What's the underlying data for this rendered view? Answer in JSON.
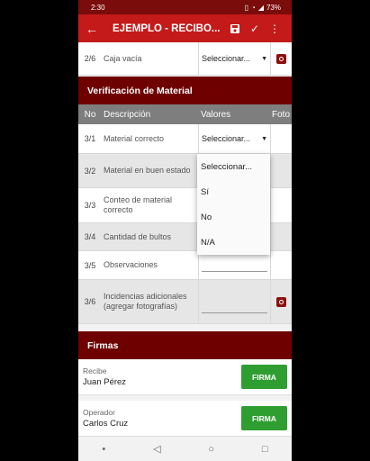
{
  "status_bar": {
    "time": "2:30",
    "battery": "73%"
  },
  "app_bar": {
    "title": "EJEMPLO - RECIBO..."
  },
  "top_row": {
    "no": "2/6",
    "desc": "Caja vacía",
    "value": "Seleccionar..."
  },
  "section_verification": {
    "title": "Verificación de Material"
  },
  "table_headers": {
    "no": "No",
    "desc": "Descripción",
    "val": "Valores",
    "foto": "Foto"
  },
  "rows": [
    {
      "no": "3/1",
      "desc": "Material correcto",
      "value": "Seleccionar..."
    },
    {
      "no": "3/2",
      "desc": "Material en buen estado"
    },
    {
      "no": "3/3",
      "desc": "Conteo de material correcto"
    },
    {
      "no": "3/4",
      "desc": "Cantidad de bultos"
    },
    {
      "no": "3/5",
      "desc": "Observaciones"
    },
    {
      "no": "3/6",
      "desc": "Incidencias adicionales (agregar fotografías)"
    }
  ],
  "dropdown": {
    "options": [
      "Seleccionar...",
      "Sí",
      "No",
      "N/A"
    ]
  },
  "section_firmas": {
    "title": "Firmas"
  },
  "signatures": [
    {
      "role": "Recibe",
      "name": "Juan Pérez",
      "button": "FIRMA"
    },
    {
      "role": "Operador",
      "name": "Carlos Cruz",
      "button": "FIRMA"
    }
  ],
  "colors": {
    "primary": "#c41a1a",
    "dark": "#6e0000",
    "header_grey": "#7e7e7e",
    "sign_button": "#2e9e30"
  }
}
